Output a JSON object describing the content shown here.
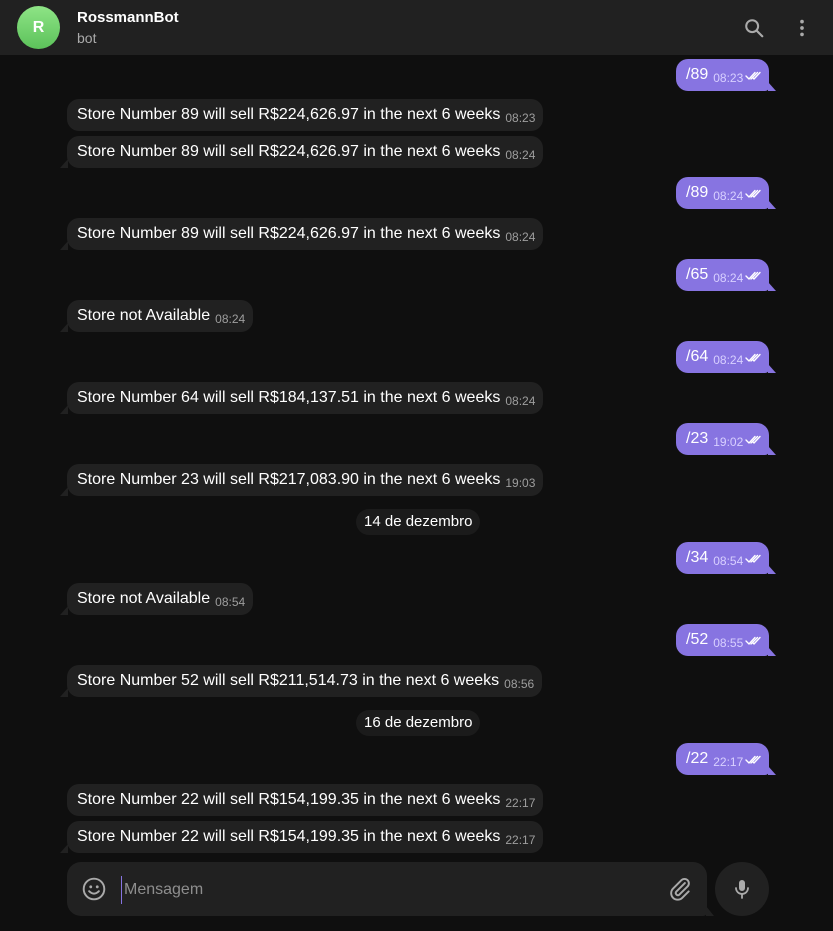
{
  "header": {
    "avatar_letter": "R",
    "title": "RossmannBot",
    "subtitle": "bot"
  },
  "composer": {
    "placeholder": "Mensagem"
  },
  "messages": [
    {
      "dir": "out",
      "text": "/89",
      "time": "08:23"
    },
    {
      "dir": "in",
      "text": "Store Number 89 will sell R$224,626.97 in the next 6 weeks",
      "time": "08:23"
    },
    {
      "dir": "in",
      "text": "Store Number 89 will sell R$224,626.97 in the next 6 weeks",
      "time": "08:24"
    },
    {
      "dir": "out",
      "text": "/89",
      "time": "08:24"
    },
    {
      "dir": "in",
      "text": "Store Number 89 will sell R$224,626.97 in the next 6 weeks",
      "time": "08:24"
    },
    {
      "dir": "out",
      "text": "/65",
      "time": "08:24"
    },
    {
      "dir": "in",
      "text": "Store not Available",
      "time": "08:24"
    },
    {
      "dir": "out",
      "text": "/64",
      "time": "08:24"
    },
    {
      "dir": "in",
      "text": "Store Number 64 will sell R$184,137.51 in the next 6 weeks",
      "time": "08:24"
    },
    {
      "dir": "out",
      "text": "/23",
      "time": "19:02"
    },
    {
      "dir": "in",
      "text": "Store Number 23 will sell R$217,083.90 in the next 6 weeks",
      "time": "19:03"
    },
    {
      "dir": "date",
      "text": "14 de dezembro"
    },
    {
      "dir": "out",
      "text": "/34",
      "time": "08:54"
    },
    {
      "dir": "in",
      "text": "Store not Available",
      "time": "08:54"
    },
    {
      "dir": "out",
      "text": "/52",
      "time": "08:55"
    },
    {
      "dir": "in",
      "text": "Store Number 52 will sell R$211,514.73 in the next 6 weeks",
      "time": "08:56"
    },
    {
      "dir": "date",
      "text": "16 de dezembro"
    },
    {
      "dir": "out",
      "text": "/22",
      "time": "22:17"
    },
    {
      "dir": "in",
      "text": "Store Number 22 will sell R$154,199.35 in the next 6 weeks",
      "time": "22:17"
    },
    {
      "dir": "in",
      "text": "Store Number 22 will sell R$154,199.35 in the next 6 weeks",
      "time": "22:17"
    }
  ]
}
